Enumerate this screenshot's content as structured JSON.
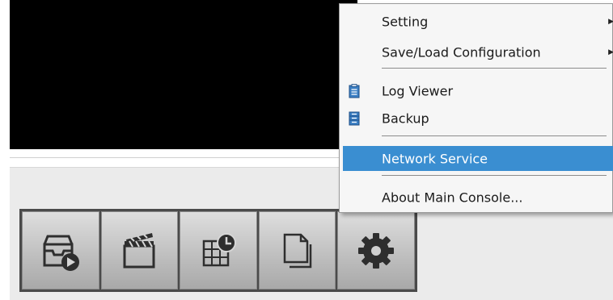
{
  "menu": {
    "items": [
      {
        "label": "Setting",
        "submenu": true
      },
      {
        "label": "Save/Load Configuration",
        "submenu": true
      },
      {
        "label": "Log Viewer",
        "icon": "log-viewer-icon"
      },
      {
        "label": "Backup",
        "icon": "backup-icon"
      },
      {
        "label": "Network Service",
        "highlighted": true
      },
      {
        "label": "About Main Console..."
      }
    ],
    "submenu_arrow": "▶",
    "highlight_color": "#3a8ed1"
  },
  "toolbar": {
    "buttons": [
      {
        "icon": "playback-icon"
      },
      {
        "icon": "clapperboard-icon"
      },
      {
        "icon": "schedule-icon"
      },
      {
        "icon": "document-icon"
      },
      {
        "icon": "gear-icon"
      }
    ]
  }
}
